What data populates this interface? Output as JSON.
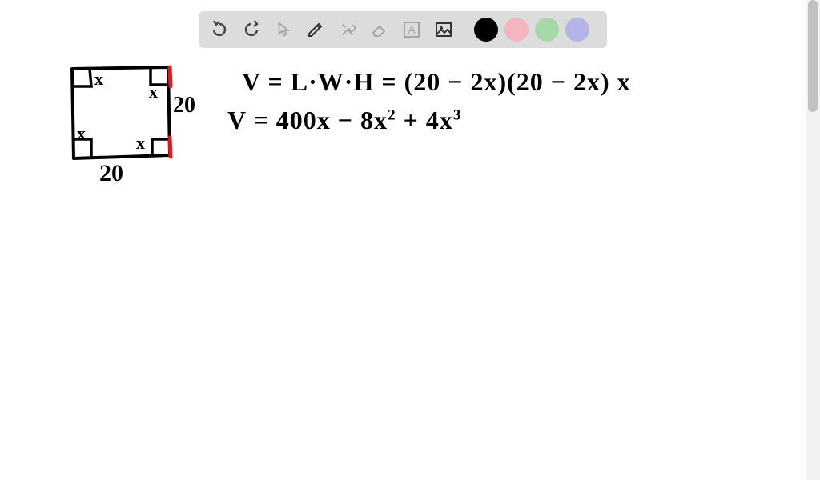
{
  "toolbar": {
    "undo": "undo",
    "redo": "redo",
    "pointer": "pointer",
    "pencil": "pencil",
    "tools": "tools",
    "eraser": "eraser",
    "text": "A",
    "image": "image"
  },
  "colors": {
    "black": "#000000",
    "pink": "#f4b4c0",
    "green": "#a8d8a8",
    "purple": "#b4b4e8"
  },
  "diagram": {
    "side_right": "20",
    "side_bottom": "20",
    "corner_label": "x"
  },
  "equations": {
    "line1": "V = L·W·H = (20 − 2x)(20 − 2x) x",
    "line2_prefix": "V = 400x − 8x",
    "line2_exp1": "2",
    "line2_mid": " + 4x",
    "line2_exp2": "3"
  }
}
